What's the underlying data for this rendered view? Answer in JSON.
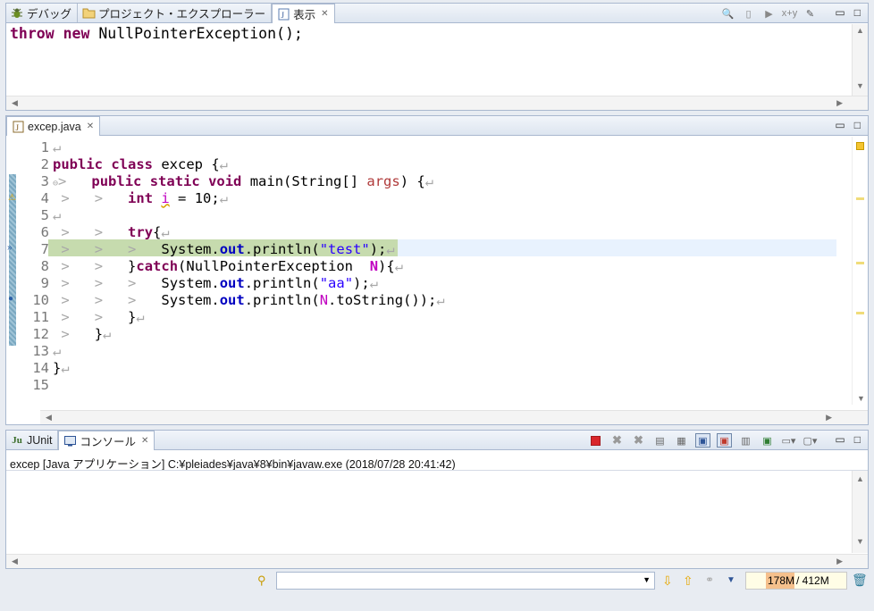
{
  "top_pane": {
    "tabs": [
      {
        "label": "デバッグ",
        "icon": "debug-bug-icon"
      },
      {
        "label": "プロジェクト・エクスプローラー",
        "icon": "folder-icon"
      },
      {
        "label": "表示",
        "icon": "display-view-icon",
        "active": true
      }
    ],
    "expression": "throw new NullPointerException();"
  },
  "editor": {
    "tab_label": "excep.java",
    "lines": [
      "1",
      "2",
      "3",
      "4",
      "5",
      "6",
      "7",
      "8",
      "9",
      "10",
      "11",
      "12",
      "13",
      "14",
      "15"
    ],
    "code": {
      "l2_kw1": "public",
      "l2_kw2": "class",
      "l2_rest": " excep {",
      "l3_kw1": "public",
      "l3_kw2": "static",
      "l3_kw3": "void",
      "l3_mid": " main(String[] ",
      "l3_par": "args",
      "l3_end": ") {",
      "l4_kw": "int",
      "l4_var": "i",
      "l4_rest": " = 10;",
      "l6_kw": "try",
      "l6_rest": "{",
      "l7_a": "System.",
      "l7_fld": "out",
      "l7_b": ".println(",
      "l7_str": "\"test\"",
      "l7_c": ");",
      "l8_a": "}",
      "l8_kw": "catch",
      "l8_b": "(NullPointerException  ",
      "l8_loc": "N",
      "l8_c": "){",
      "l9_a": "System.",
      "l9_fld": "out",
      "l9_b": ".println(",
      "l9_str": "\"aa\"",
      "l9_c": ");",
      "l10_a": "System.",
      "l10_fld": "out",
      "l10_b": ".println(",
      "l10_loc": "N",
      "l10_c": ".toString());",
      "l11": "}",
      "l12": "}",
      "l14": "}"
    },
    "whitespace_marker": ">",
    "newline_marker": "↵"
  },
  "console": {
    "tabs": [
      {
        "label": "JUnit",
        "icon": "junit-icon"
      },
      {
        "label": "コンソール",
        "icon": "console-icon",
        "active": true
      }
    ],
    "launch_info": "excep [Java アプリケーション] C:¥pleiades¥java¥8¥bin¥javaw.exe (2018/07/28 20:41:42)"
  },
  "status_bar": {
    "memory_used": "178M",
    "memory_total": " / 412M",
    "search_value": ""
  },
  "colors": {
    "current_line": "#c6dbae",
    "highlight_row": "#e8f2fe",
    "keyword": "#7f0055",
    "field": "#0000c0",
    "string": "#2a00ff",
    "terminate_red": "#d9262b"
  }
}
